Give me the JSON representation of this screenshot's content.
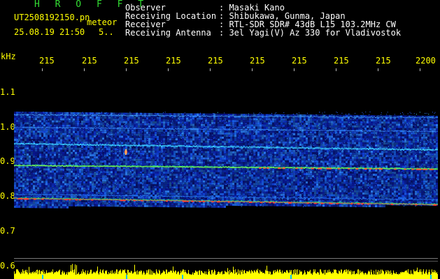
{
  "header": {
    "app_title": "H R O F F T",
    "filename": "UT2508192150.pn",
    "event_label": "meteor",
    "datetime": "25.08.19 21:50",
    "page_indicator": "5..",
    "fields": [
      {
        "label": "Observer",
        "value": ": Masaki Kano"
      },
      {
        "label": "Receiving Location",
        "value": ": Shibukawa, Gunma, Japan"
      },
      {
        "label": "Receiver",
        "value": ": RTL-SDR SDR# 43dB L15 103.2MHz CW"
      },
      {
        "label": "Receiving Antenna",
        "value": ": 3el Yagi(V) Az 330 for Vladivostok"
      }
    ]
  },
  "axes": {
    "y_unit": "kHz",
    "y_ticks": [
      "1.1",
      "1.0",
      "0.9",
      "0.8",
      "0.7",
      "0.6"
    ],
    "x_ticks": [
      "215",
      "215",
      "215",
      "215",
      "215",
      "215",
      "215",
      "215",
      "215",
      "2200"
    ]
  },
  "colors": {
    "background": "#000000",
    "text_header": "#ffffff",
    "text_axis": "#ffff00",
    "title": "#33dd33",
    "amplitude_strip": "#ffff00"
  }
}
